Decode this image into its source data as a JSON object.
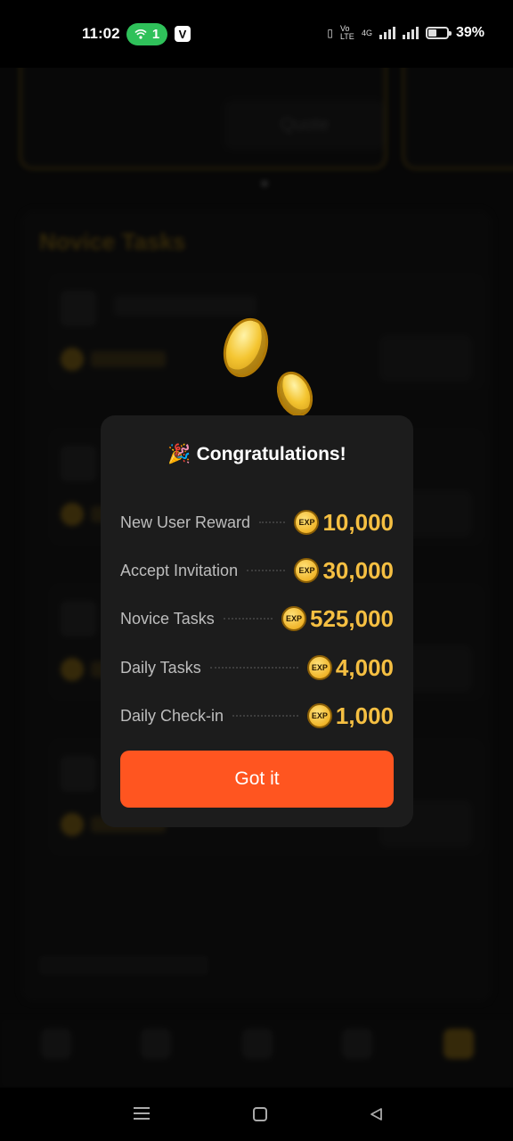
{
  "status_bar": {
    "time": "11:02",
    "hotspot_count": "1",
    "carrier_badge": "V",
    "volte_label": "Vo LTE",
    "network_label": "4G",
    "battery_percent": "39%",
    "battery_level": 0.39
  },
  "background_app": {
    "quote_button": "Quote",
    "section_title": "Novice Tasks",
    "accent_color": "#d7a21a"
  },
  "modal": {
    "title": "Congratulations!",
    "title_icon": "party-popper-icon",
    "rewards": [
      {
        "label": "New User Reward",
        "value": "10,000",
        "icon": "exp-coin-icon"
      },
      {
        "label": "Accept Invitation",
        "value": "30,000",
        "icon": "exp-coin-icon"
      },
      {
        "label": "Novice Tasks",
        "value": "525,000",
        "icon": "exp-coin-icon"
      },
      {
        "label": "Daily Tasks",
        "value": "4,000",
        "icon": "exp-coin-icon"
      },
      {
        "label": "Daily Check-in",
        "value": "1,000",
        "icon": "exp-coin-icon"
      }
    ],
    "exp_badge_text": "EXP",
    "button_label": "Got it",
    "button_color": "#ff5520",
    "value_color": "#f5bf42"
  },
  "nav_bar": {
    "icons": [
      "menu-icon",
      "home-icon",
      "back-icon"
    ]
  }
}
